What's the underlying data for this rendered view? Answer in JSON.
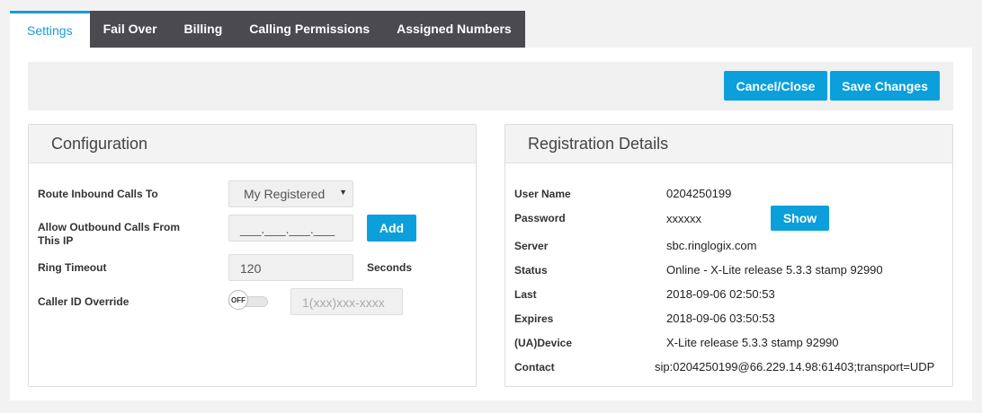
{
  "tabs": [
    {
      "label": "Settings",
      "active": true
    },
    {
      "label": "Fail Over"
    },
    {
      "label": "Billing"
    },
    {
      "label": "Calling Permissions"
    },
    {
      "label": "Assigned Numbers"
    }
  ],
  "actions": {
    "cancel_label": "Cancel/Close",
    "save_label": "Save Changes"
  },
  "configuration": {
    "title": "Configuration",
    "route_label": "Route Inbound Calls To",
    "route_value": "My Registered",
    "allow_label": "Allow Outbound Calls From This IP",
    "allow_placeholder": "___.___.___.___",
    "add_label": "Add",
    "ring_label": "Ring Timeout",
    "ring_value": "120",
    "ring_unit": "Seconds",
    "callerid_label": "Caller ID Override",
    "callerid_toggle": "OFF",
    "callerid_placeholder": "1(xxx)xxx-xxxx"
  },
  "registration": {
    "title": "Registration Details",
    "show_label": "Show",
    "rows": [
      {
        "label": "User Name",
        "value": "0204250199"
      },
      {
        "label": "Password",
        "value": "xxxxxx"
      },
      {
        "label": "Server",
        "value": "sbc.ringlogix.com"
      },
      {
        "label": "Status",
        "value": "Online - X-Lite release 5.3.3 stamp 92990"
      },
      {
        "label": "Last",
        "value": "2018-09-06 02:50:53"
      },
      {
        "label": "Expires",
        "value": "2018-09-06 03:50:53"
      },
      {
        "label": "(UA)Device",
        "value": "X-Lite release 5.3.3 stamp 92990"
      },
      {
        "label": "Contact",
        "value": "sip:0204250199@66.229.14.98:61403;transport=UDP"
      }
    ]
  },
  "colors": {
    "accent": "#0b9fdb",
    "tab_bar": "#4a4a4f",
    "active_tab_text": "#1a9bd7"
  }
}
